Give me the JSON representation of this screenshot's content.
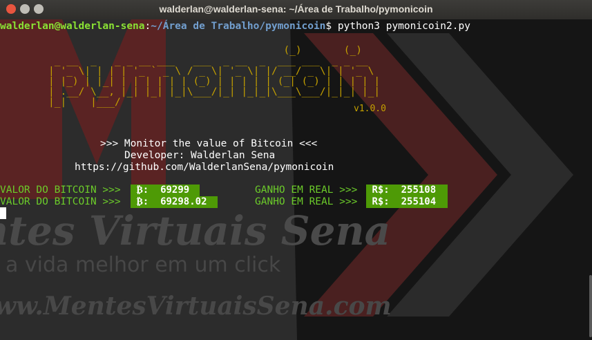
{
  "window": {
    "title": "walderlan@walderlan-sena: ~/Área de Trabalho/pymonicoin"
  },
  "prompt": {
    "user_host": "walderlan@walderlan-sena",
    "separator": ":",
    "path": "~/Área de Trabalho/pymonicoin",
    "symbol": "$",
    "command": " python3 pymonicoin2.py"
  },
  "banner": {
    "ascii": "                                       (_)       (_)\n _ __  _   _ _ __ ___   ___  _ __  _  ___ ___  _ _ __\n| '_ \\| | | | '_ ` _ \\ / _ \\| '_ \\| |/ __/ _ \\| | '_ \\\n| |_) | |_| | | | | | | (_) | | | | | (_| (_) | | | | |\n| .__/ \\__, |_| |_| |_|\\___/|_| |_|_|\\___\\___/|_|_| |_|\n|_|    |___/",
    "version": "v1.0.0"
  },
  "info": {
    "line1": ">>> Monitor the value of Bitcoin <<<",
    "line2": "Developer: Walderlan Sena",
    "line3": "https://github.com/WalderlanSena/pymonicoin"
  },
  "rows": [
    {
      "label": "VALOR DO BITCOIN >>>",
      "btc_symbol": "₿:",
      "btc_value": "69299",
      "gain_label": "GANHO EM REAL >>>",
      "brl_symbol": "R$:",
      "brl_value": "255108"
    },
    {
      "label": "VALOR DO BITCOIN >>>",
      "btc_symbol": "₿:",
      "btc_value": "69298.02",
      "gain_label": "GANHO EM REAL >>>",
      "brl_symbol": "R$:",
      "brl_value": "255104"
    }
  ],
  "background": {
    "line1": "ntes Virtuais Sena",
    "line2": "a vida melhor em um click",
    "line3": "ww.MentesVirtuaisSena.com"
  },
  "colors": {
    "accent_green": "#4e9a06",
    "banner_yellow": "#c4a000",
    "prompt_user": "#8ae234",
    "prompt_path": "#729fcf"
  }
}
